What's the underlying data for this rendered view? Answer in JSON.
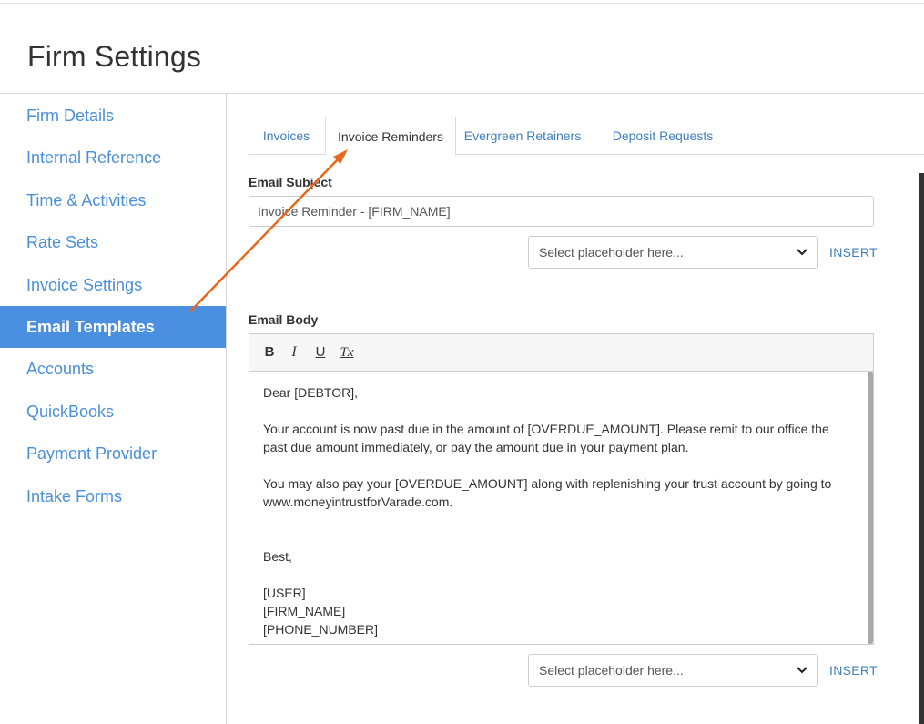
{
  "page": {
    "title": "Firm Settings"
  },
  "sidebar": {
    "items": [
      {
        "label": "Firm Details"
      },
      {
        "label": "Internal Reference"
      },
      {
        "label": "Time & Activities"
      },
      {
        "label": "Rate Sets"
      },
      {
        "label": "Invoice Settings"
      },
      {
        "label": "Email Templates",
        "active": true
      },
      {
        "label": "Accounts"
      },
      {
        "label": "QuickBooks"
      },
      {
        "label": "Payment Provider"
      },
      {
        "label": "Intake Forms"
      }
    ]
  },
  "tabs": [
    {
      "label": "Invoices"
    },
    {
      "label": "Invoice Reminders",
      "active": true
    },
    {
      "label": "Evergreen Retainers"
    },
    {
      "label": "Deposit Requests"
    }
  ],
  "subject": {
    "label": "Email Subject",
    "value": "Invoice Reminder - [FIRM_NAME]",
    "placeholder_select": "Select placeholder here...",
    "insert_label": "INSERT"
  },
  "body": {
    "label": "Email Body",
    "toolbar": {
      "bold": "B",
      "italic": "I",
      "underline": "U",
      "clear": "Tx"
    },
    "lines": [
      "Dear [DEBTOR],",
      "",
      "Your account is now past due in the amount of [OVERDUE_AMOUNT]. Please remit to our office the past due amount immediately, or pay the amount due in your payment plan.",
      "",
      "You may also pay your [OVERDUE_AMOUNT] along with replenishing your trust account by going to www.moneyintrustforVarade.com.",
      "",
      "",
      "Best,",
      "",
      "[USER]",
      "[FIRM_NAME]",
      "[PHONE_NUMBER]"
    ],
    "placeholder_select": "Select placeholder here...",
    "insert_label": "INSERT"
  },
  "colors": {
    "accent": "#4a8fe0",
    "link": "#3f7fbf",
    "annotation_arrow": "#e8671c"
  }
}
